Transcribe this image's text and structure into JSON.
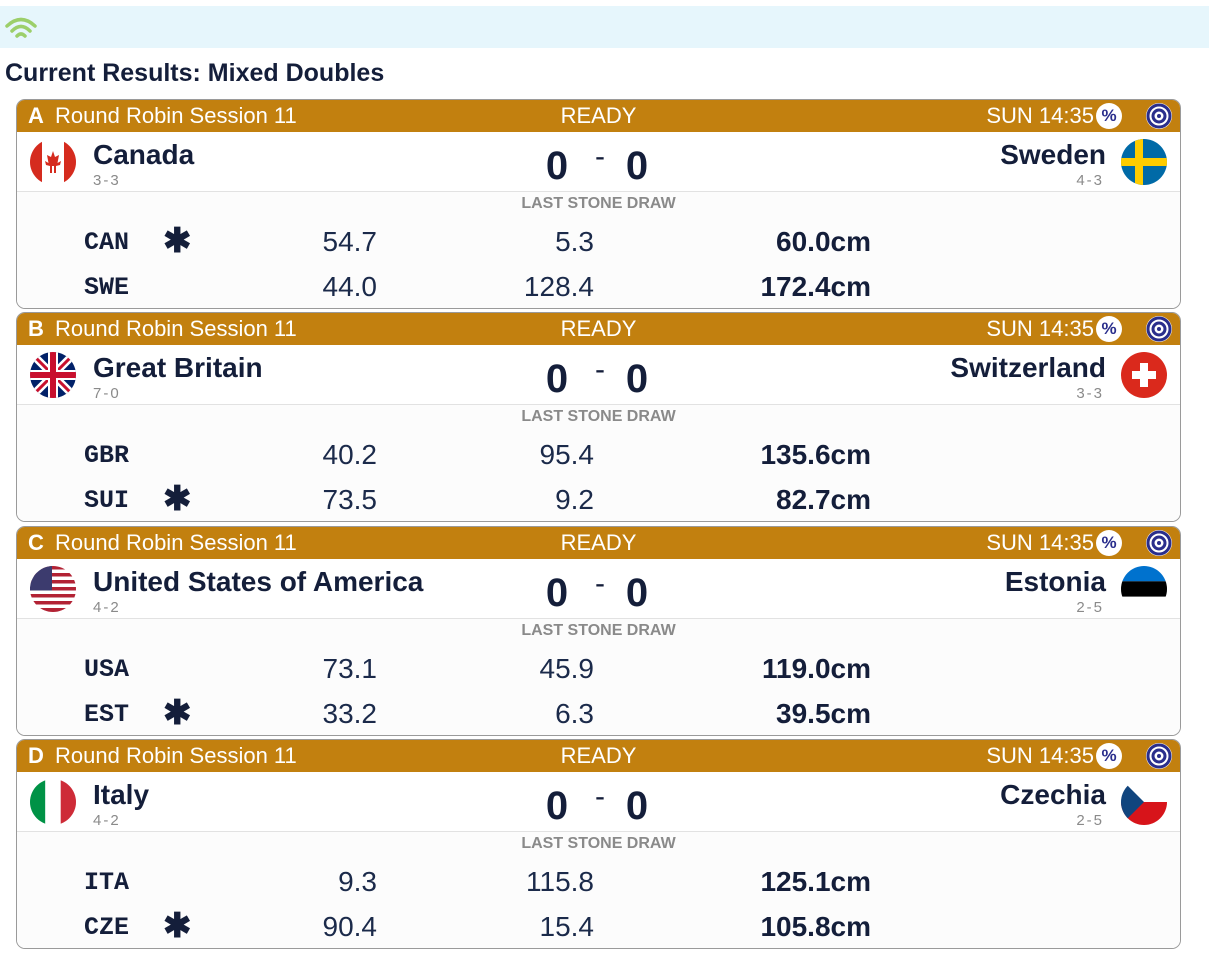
{
  "header": {
    "connection_icon": "wifi-icon"
  },
  "page_title": "Current Results: Mixed Doubles",
  "section_label": "LAST STONE DRAW",
  "colors": {
    "header_bar": "#c2800f",
    "title_text": "#141e3a",
    "top_bar": "#e6f6fc"
  },
  "games": [
    {
      "sheet": "A",
      "session": "Round Robin Session 11",
      "status": "READY",
      "time": "SUN 14:35",
      "percent_label": "%",
      "left": {
        "name": "Canada",
        "record": "3-3",
        "flag": "canada",
        "score": "0"
      },
      "right": {
        "name": "Sweden",
        "record": "4-3",
        "flag": "sweden",
        "score": "0"
      },
      "lsd": [
        {
          "code": "CAN",
          "hammer": "✱",
          "draw1": "54.7",
          "draw2": "5.3",
          "total": "60.0cm"
        },
        {
          "code": "SWE",
          "hammer": "",
          "draw1": "44.0",
          "draw2": "128.4",
          "total": "172.4cm"
        }
      ]
    },
    {
      "sheet": "B",
      "session": "Round Robin Session 11",
      "status": "READY",
      "time": "SUN 14:35",
      "percent_label": "%",
      "left": {
        "name": "Great Britain",
        "record": "7-0",
        "flag": "great-britain",
        "score": "0"
      },
      "right": {
        "name": "Switzerland",
        "record": "3-3",
        "flag": "switzerland",
        "score": "0"
      },
      "lsd": [
        {
          "code": "GBR",
          "hammer": "",
          "draw1": "40.2",
          "draw2": "95.4",
          "total": "135.6cm"
        },
        {
          "code": "SUI",
          "hammer": "✱",
          "draw1": "73.5",
          "draw2": "9.2",
          "total": "82.7cm"
        }
      ]
    },
    {
      "sheet": "C",
      "session": "Round Robin Session 11",
      "status": "READY",
      "time": "SUN 14:35",
      "percent_label": "%",
      "left": {
        "name": "United States of America",
        "record": "4-2",
        "flag": "usa",
        "score": "0"
      },
      "right": {
        "name": "Estonia",
        "record": "2-5",
        "flag": "estonia",
        "score": "0"
      },
      "lsd": [
        {
          "code": "USA",
          "hammer": "",
          "draw1": "73.1",
          "draw2": "45.9",
          "total": "119.0cm"
        },
        {
          "code": "EST",
          "hammer": "✱",
          "draw1": "33.2",
          "draw2": "6.3",
          "total": "39.5cm"
        }
      ]
    },
    {
      "sheet": "D",
      "session": "Round Robin Session 11",
      "status": "READY",
      "time": "SUN 14:35",
      "percent_label": "%",
      "left": {
        "name": "Italy",
        "record": "4-2",
        "flag": "italy",
        "score": "0"
      },
      "right": {
        "name": "Czechia",
        "record": "2-5",
        "flag": "czechia",
        "score": "0"
      },
      "lsd": [
        {
          "code": "ITA",
          "hammer": "",
          "draw1": "9.3",
          "draw2": "115.8",
          "total": "125.1cm"
        },
        {
          "code": "CZE",
          "hammer": "✱",
          "draw1": "90.4",
          "draw2": "15.4",
          "total": "105.8cm"
        }
      ]
    }
  ]
}
